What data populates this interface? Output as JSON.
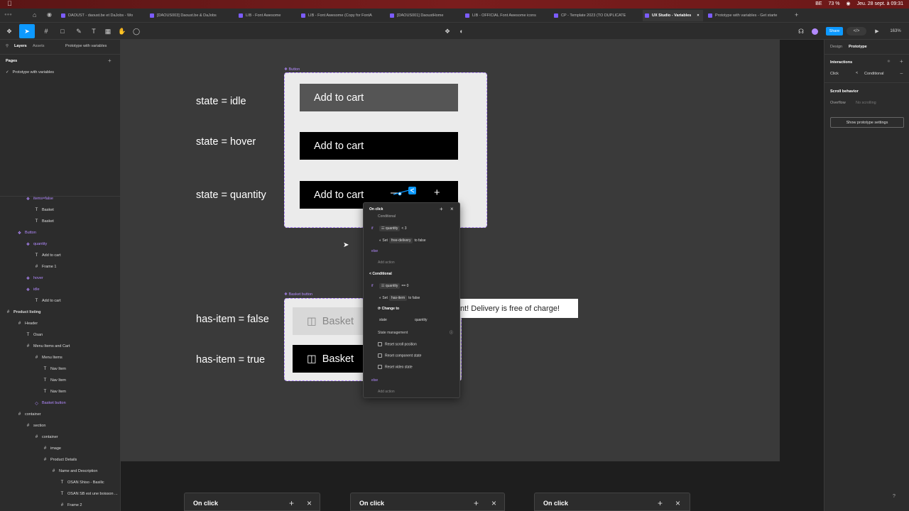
{
  "menubar": {
    "clock": "Jeu. 28 sept. à 09:31",
    "battery": "73 %",
    "keyboard": "BE"
  },
  "browser_tabs": [
    {
      "label": "DAOUST - daoust.be et DaJobs - Wo"
    },
    {
      "label": "[DAOUS003] Daoust.be & DaJobs"
    },
    {
      "label": "LIB - Font Awesome"
    },
    {
      "label": "LIB - Font Awesome (Copy for FontA"
    },
    {
      "label": "[DAOUS001] DaoustHome"
    },
    {
      "label": "LIB - OFFICIAL Font Awesome icons"
    },
    {
      "label": "CP - Template 2023 (TO DUPLICATE"
    },
    {
      "label": "UX Studio - Variables"
    },
    {
      "label": "Prototype with variables - Get starte"
    }
  ],
  "toolbar": {
    "share_label": "Share",
    "zoom": "163%"
  },
  "left_panel": {
    "tab_layers": "Layers",
    "tab_assets": "Assets",
    "page_selector": "Prototype with variables",
    "pages_heading": "Pages",
    "page_item": "Prototype with variables",
    "layers": [
      {
        "label": "items=false",
        "type": "component"
      },
      {
        "label": "Basket",
        "type": "text"
      },
      {
        "label": "Basket",
        "type": "text"
      },
      {
        "label": "Button",
        "type": "component-set"
      },
      {
        "label": "quantity",
        "type": "component"
      },
      {
        "label": "Add to cart",
        "type": "text"
      },
      {
        "label": "Frame 1",
        "type": "frame"
      },
      {
        "label": "hover",
        "type": "component"
      },
      {
        "label": "idle",
        "type": "component"
      },
      {
        "label": "Add to cart",
        "type": "text"
      },
      {
        "label": "Product listing",
        "type": "frame"
      },
      {
        "label": "Header",
        "type": "frame"
      },
      {
        "label": "Osan",
        "type": "text"
      },
      {
        "label": "Menu Items and Cart",
        "type": "frame"
      },
      {
        "label": "Menu Items",
        "type": "frame"
      },
      {
        "label": "Nav Item",
        "type": "text"
      },
      {
        "label": "Nav Item",
        "type": "text"
      },
      {
        "label": "Nav Item",
        "type": "text"
      },
      {
        "label": "Basket button",
        "type": "instance"
      },
      {
        "label": "container",
        "type": "frame"
      },
      {
        "label": "section",
        "type": "frame"
      },
      {
        "label": "container",
        "type": "frame"
      },
      {
        "label": "image",
        "type": "frame"
      },
      {
        "label": "Product Details",
        "type": "frame"
      },
      {
        "label": "Name and Description",
        "type": "frame"
      },
      {
        "label": "OSAN Shiso - Basilic",
        "type": "text"
      },
      {
        "label": "OSAN SB est une boisson ...",
        "type": "text"
      },
      {
        "label": "Frame 2",
        "type": "frame"
      }
    ]
  },
  "canvas": {
    "button_component_label": "Button",
    "basket_component_label": "Basket button",
    "state_labels": [
      "state = idle",
      "state = hover",
      "state = quantity"
    ],
    "button_text": "Add to cart",
    "quantity_minus": "—",
    "quantity_plus": "+",
    "basket_labels": [
      "has-item = false",
      "has-item = true"
    ],
    "basket_text": "Basket",
    "toast_text": "nt! Delivery is free of charge!"
  },
  "popup": {
    "title": "On click",
    "conditional_top": "Conditional",
    "if1": "if",
    "cond1_var": "quantity",
    "cond1_op": "< 3",
    "action1_set": "Set",
    "action1_var": "free-delivery",
    "action1_to": "to false",
    "else1": "else",
    "add_action1": "Add action",
    "conditional2": "Conditional",
    "if2": "if",
    "cond2_var": "quantity",
    "cond2_op": "== 0",
    "action2_set": "Set",
    "action2_var": "has-item",
    "action2_to": "to false",
    "change_to": "Change to",
    "state_key": "state",
    "state_val": "quantity",
    "state_mgmt": "State management",
    "reset_scroll": "Reset scroll position",
    "reset_component": "Reset component state",
    "reset_video": "Reset video state",
    "else2": "else",
    "add_action2": "Add action"
  },
  "right_panel": {
    "tab_design": "Design",
    "tab_prototype": "Prototype",
    "interactions_heading": "Interactions",
    "trigger": "Click",
    "action": "Conditional",
    "scroll_heading": "Scroll behavior",
    "overflow_label": "Overflow",
    "overflow_value": "No scrolling",
    "settings_button": "Show prototype settings"
  },
  "bottom_panels": [
    {
      "title": "On click"
    },
    {
      "title": "On click"
    },
    {
      "title": "On click"
    }
  ],
  "colors": {
    "accent": "#0d99ff",
    "component": "#b38aff",
    "menubar": "#6b1818"
  }
}
